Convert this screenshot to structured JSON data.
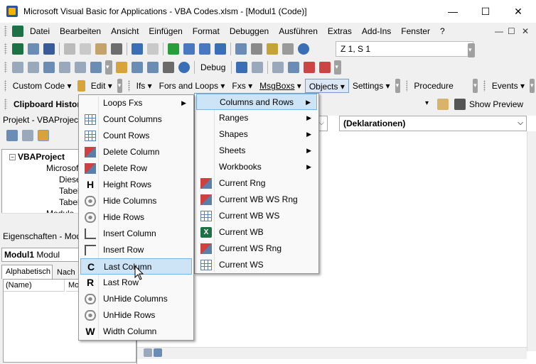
{
  "window": {
    "title": "Microsoft Visual Basic for Applications - VBA Codes.xlsm - [Modul1 (Code)]",
    "min_glyph": "—",
    "max_glyph": "☐",
    "close_glyph": "✕"
  },
  "menubar": {
    "items": [
      "Datei",
      "Bearbeiten",
      "Ansicht",
      "Einfügen",
      "Format",
      "Debuggen",
      "Ausführen",
      "Extras",
      "Add-Ins",
      "Fenster",
      "?"
    ],
    "mdi": [
      "—",
      "☐",
      "✕"
    ]
  },
  "toolbar1": {
    "position": "Z 1, S 1"
  },
  "toolbar2": {
    "debug_label": "Debug"
  },
  "toolbar3": {
    "custom_code": "Custom Code",
    "edit": "Edit",
    "ifs": "Ifs",
    "fors": "Fors and Loops",
    "fxs": "Fxs",
    "msgboxs": "MsgBoxs",
    "objects": "Objects",
    "settings": "Settings",
    "procedure": "Procedure",
    "events": "Events"
  },
  "toolbar4": {
    "clipboard": "Clipboard History",
    "show_preview": "Show Preview"
  },
  "project_pane": {
    "title": "Projekt - VBAProject",
    "tree": [
      "VBAProject",
      "Microsoft",
      "Diese",
      "Tabel",
      "Tabel",
      "Module"
    ]
  },
  "properties_pane": {
    "title": "Eigenschaften - Modu",
    "object_name": "Modul1",
    "object_type": "Modul",
    "tabs": [
      "Alphabetisch",
      "Nach"
    ],
    "row_name": "(Name)",
    "row_value": "Mo"
  },
  "code_window": {
    "proc_combo": "(Deklarationen)"
  },
  "menu_main": {
    "items": [
      {
        "label": "Loops Fxs",
        "icon": "none",
        "submenu": true
      },
      {
        "label": "Count Columns",
        "icon": "grid-columns-icon"
      },
      {
        "label": "Count Rows",
        "icon": "grid-rows-icon"
      },
      {
        "label": "Delete Column",
        "icon": "delete-column-icon"
      },
      {
        "label": "Delete Row",
        "icon": "delete-row-icon"
      },
      {
        "label": "Height Rows",
        "icon": "letter-h-icon",
        "letter": "H"
      },
      {
        "label": "Hide Columns",
        "icon": "eye-icon"
      },
      {
        "label": "Hide Rows",
        "icon": "eye-icon"
      },
      {
        "label": "Insert Column",
        "icon": "insert-column-icon"
      },
      {
        "label": "Insert Row",
        "icon": "insert-row-icon"
      },
      {
        "label": "Last Column",
        "icon": "letter-c-icon",
        "letter": "C",
        "highlighted": true
      },
      {
        "label": "Last Row",
        "icon": "letter-r-icon",
        "letter": "R"
      },
      {
        "label": "UnHide Columns",
        "icon": "eye-icon"
      },
      {
        "label": "UnHide Rows",
        "icon": "eye-icon"
      },
      {
        "label": "Width Column",
        "icon": "letter-w-icon",
        "letter": "W"
      }
    ]
  },
  "menu_objects": {
    "items": [
      {
        "label": "Columns and Rows",
        "submenu": true,
        "highlighted": true
      },
      {
        "label": "Ranges",
        "submenu": true
      },
      {
        "label": "Shapes",
        "submenu": true
      },
      {
        "label": "Sheets",
        "submenu": true
      },
      {
        "label": "Workbooks",
        "submenu": true
      },
      {
        "label": "Current Rng",
        "icon": "range-icon"
      },
      {
        "label": "Current WB WS Rng",
        "icon": "range-icon"
      },
      {
        "label": "Current WB WS",
        "icon": "grid-icon"
      },
      {
        "label": "Current WB",
        "icon": "excel-icon"
      },
      {
        "label": "Current WS Rng",
        "icon": "range-icon"
      },
      {
        "label": "Current WS",
        "icon": "grid-icon"
      }
    ]
  }
}
